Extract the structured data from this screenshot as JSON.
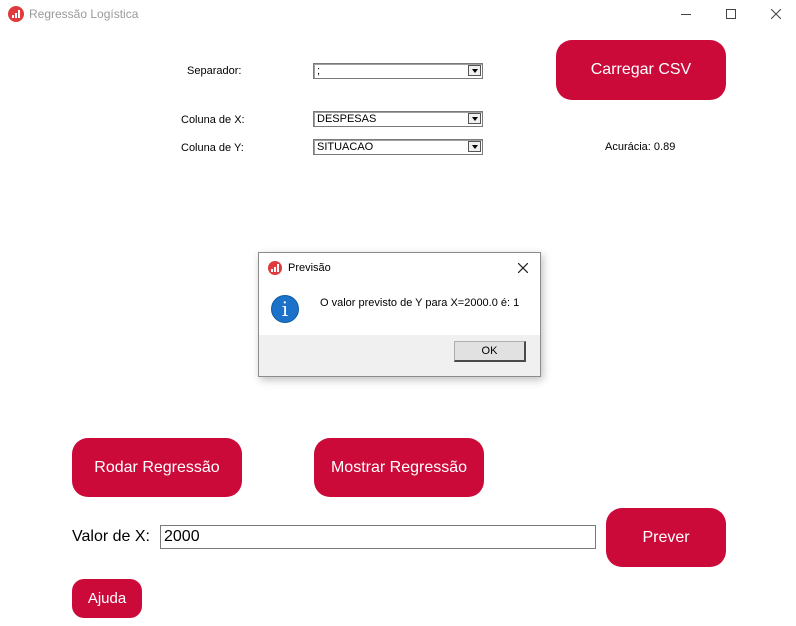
{
  "window": {
    "title": "Regressão Logística",
    "icon": "bar-chart-icon",
    "brand_color": "#cc0a3a"
  },
  "config": {
    "separator_label": "Separador:",
    "separator_value": ";",
    "col_x_label": "Coluna de X:",
    "col_x_value": "DESPESAS",
    "col_y_label": "Coluna de Y:",
    "col_y_value": "SITUACAO",
    "accuracy_text": "Acurácia: 0.89"
  },
  "buttons": {
    "load_csv": "Carregar CSV",
    "run_regression": "Rodar Regressão",
    "show_regression": "Mostrar Regressão",
    "predict": "Prever",
    "help": "Ajuda"
  },
  "prediction": {
    "x_label": "Valor de X:",
    "x_value": "2000"
  },
  "dialog": {
    "title": "Previsão",
    "message": "O valor previsto de Y para X=2000.0 é: 1",
    "ok_label": "OK",
    "icon": "info-icon"
  }
}
